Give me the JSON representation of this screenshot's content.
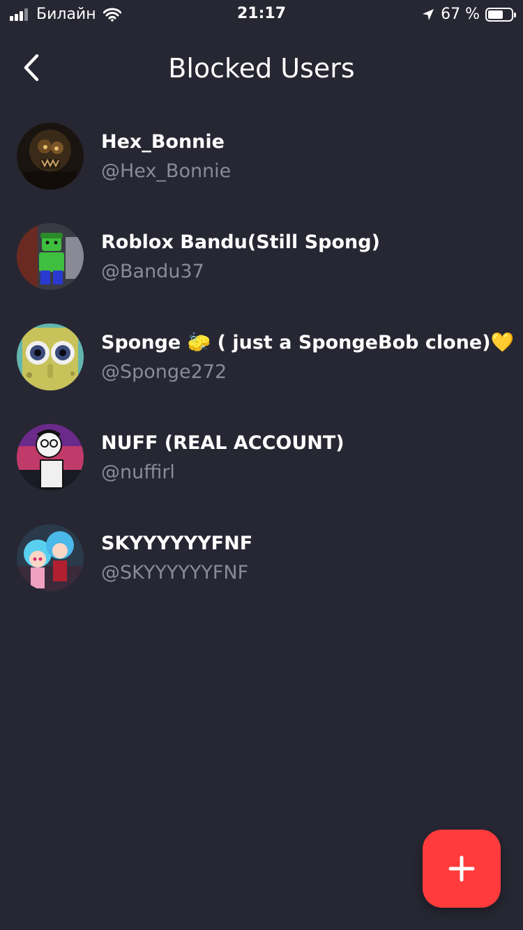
{
  "status_bar": {
    "carrier": "Билайн",
    "time": "21:17",
    "battery_percent": "67 %",
    "battery_level": 0.67,
    "icons": [
      "signal-icon",
      "wifi-icon",
      "location-arrow-icon",
      "battery-icon"
    ]
  },
  "header": {
    "title": "Blocked Users",
    "back_icon": "chevron-left-icon"
  },
  "blocked_users": [
    {
      "name": "Hex_Bonnie",
      "handle": "@Hex_Bonnie"
    },
    {
      "name": "Roblox Bandu(Still Spong)",
      "handle": "@Bandu37"
    },
    {
      "name": "Sponge 🧽  ( just a SpongeBob clone)💛",
      "handle": "@Sponge272"
    },
    {
      "name": "NUFF (REAL ACCOUNT)",
      "handle": "@nuffirl"
    },
    {
      "name": "SKYYYYYYFNF",
      "handle": "@SKYYYYYYFNF"
    }
  ],
  "fab": {
    "icon": "plus-icon"
  },
  "colors": {
    "background": "#272733",
    "text_primary": "#ffffff",
    "text_secondary": "#8b8b98",
    "accent": "#ff3b3b"
  }
}
